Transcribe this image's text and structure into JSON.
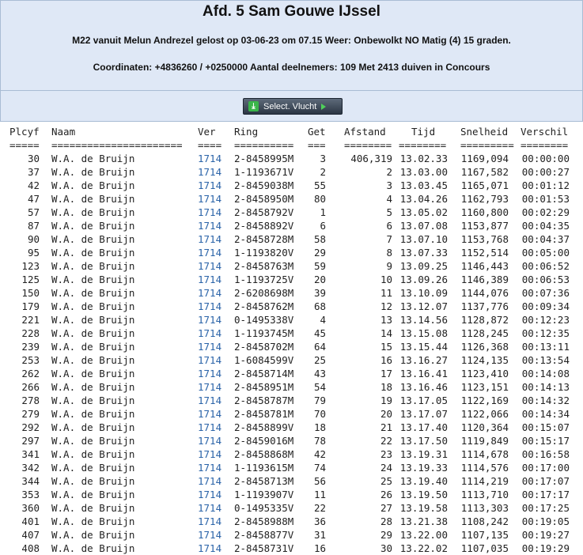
{
  "header": {
    "title": "Afd. 5 Sam Gouwe IJssel",
    "subtitle": "M22 vanuit Melun Andrezel gelost op 03-06-23 om 07.15 Weer: Onbewolkt NO Matig (4) 15 graden.",
    "coords": "Coordinaten: +4836260 / +0250000 Aantal deelnemers: 109 Met 2413 duiven in Concours"
  },
  "toolbar": {
    "select_label": "Select. Vlucht"
  },
  "table": {
    "headers": [
      "Plcyf",
      "Naam",
      "Ver",
      "Ring",
      "Get",
      "Afstand",
      "Tijd",
      "Snelheid",
      "Verschil"
    ],
    "underlines": [
      "=====",
      "======================",
      "====",
      "==========",
      "===",
      "========",
      "========",
      "=========",
      "========"
    ],
    "rows": [
      [
        "30",
        "W.A. de Bruijn",
        "1714",
        "2-8458995M",
        "3",
        "406,319",
        "13.02.33",
        "1169,094",
        "00:00:00"
      ],
      [
        "37",
        "W.A. de Bruijn",
        "1714",
        "1-1193671V",
        "2",
        "2",
        "13.03.00",
        "1167,582",
        "00:00:27"
      ],
      [
        "42",
        "W.A. de Bruijn",
        "1714",
        "2-8459038M",
        "55",
        "3",
        "13.03.45",
        "1165,071",
        "00:01:12"
      ],
      [
        "47",
        "W.A. de Bruijn",
        "1714",
        "2-8458950M",
        "80",
        "4",
        "13.04.26",
        "1162,793",
        "00:01:53"
      ],
      [
        "57",
        "W.A. de Bruijn",
        "1714",
        "2-8458792V",
        "1",
        "5",
        "13.05.02",
        "1160,800",
        "00:02:29"
      ],
      [
        "87",
        "W.A. de Bruijn",
        "1714",
        "2-8458892V",
        "6",
        "6",
        "13.07.08",
        "1153,877",
        "00:04:35"
      ],
      [
        "90",
        "W.A. de Bruijn",
        "1714",
        "2-8458728M",
        "58",
        "7",
        "13.07.10",
        "1153,768",
        "00:04:37"
      ],
      [
        "95",
        "W.A. de Bruijn",
        "1714",
        "1-1193820V",
        "29",
        "8",
        "13.07.33",
        "1152,514",
        "00:05:00"
      ],
      [
        "123",
        "W.A. de Bruijn",
        "1714",
        "2-8458763M",
        "59",
        "9",
        "13.09.25",
        "1146,443",
        "00:06:52"
      ],
      [
        "125",
        "W.A. de Bruijn",
        "1714",
        "1-1193725V",
        "20",
        "10",
        "13.09.26",
        "1146,389",
        "00:06:53"
      ],
      [
        "150",
        "W.A. de Bruijn",
        "1714",
        "2-6208698M",
        "39",
        "11",
        "13.10.09",
        "1144,076",
        "00:07:36"
      ],
      [
        "179",
        "W.A. de Bruijn",
        "1714",
        "2-8458762M",
        "68",
        "12",
        "13.12.07",
        "1137,776",
        "00:09:34"
      ],
      [
        "221",
        "W.A. de Bruijn",
        "1714",
        "0-1495338V",
        "4",
        "13",
        "13.14.56",
        "1128,872",
        "00:12:23"
      ],
      [
        "228",
        "W.A. de Bruijn",
        "1714",
        "1-1193745M",
        "45",
        "14",
        "13.15.08",
        "1128,245",
        "00:12:35"
      ],
      [
        "239",
        "W.A. de Bruijn",
        "1714",
        "2-8458702M",
        "64",
        "15",
        "13.15.44",
        "1126,368",
        "00:13:11"
      ],
      [
        "253",
        "W.A. de Bruijn",
        "1714",
        "1-6084599V",
        "25",
        "16",
        "13.16.27",
        "1124,135",
        "00:13:54"
      ],
      [
        "262",
        "W.A. de Bruijn",
        "1714",
        "2-8458714M",
        "43",
        "17",
        "13.16.41",
        "1123,410",
        "00:14:08"
      ],
      [
        "266",
        "W.A. de Bruijn",
        "1714",
        "2-8458951M",
        "54",
        "18",
        "13.16.46",
        "1123,151",
        "00:14:13"
      ],
      [
        "278",
        "W.A. de Bruijn",
        "1714",
        "2-8458787M",
        "79",
        "19",
        "13.17.05",
        "1122,169",
        "00:14:32"
      ],
      [
        "279",
        "W.A. de Bruijn",
        "1714",
        "2-8458781M",
        "70",
        "20",
        "13.17.07",
        "1122,066",
        "00:14:34"
      ],
      [
        "292",
        "W.A. de Bruijn",
        "1714",
        "2-8458899V",
        "18",
        "21",
        "13.17.40",
        "1120,364",
        "00:15:07"
      ],
      [
        "297",
        "W.A. de Bruijn",
        "1714",
        "2-8459016M",
        "78",
        "22",
        "13.17.50",
        "1119,849",
        "00:15:17"
      ],
      [
        "341",
        "W.A. de Bruijn",
        "1714",
        "2-8458868M",
        "42",
        "23",
        "13.19.31",
        "1114,678",
        "00:16:58"
      ],
      [
        "342",
        "W.A. de Bruijn",
        "1714",
        "1-1193615M",
        "74",
        "24",
        "13.19.33",
        "1114,576",
        "00:17:00"
      ],
      [
        "344",
        "W.A. de Bruijn",
        "1714",
        "2-8458713M",
        "56",
        "25",
        "13.19.40",
        "1114,219",
        "00:17:07"
      ],
      [
        "353",
        "W.A. de Bruijn",
        "1714",
        "1-1193907V",
        "11",
        "26",
        "13.19.50",
        "1113,710",
        "00:17:17"
      ],
      [
        "360",
        "W.A. de Bruijn",
        "1714",
        "0-1495335V",
        "22",
        "27",
        "13.19.58",
        "1113,303",
        "00:17:25"
      ],
      [
        "401",
        "W.A. de Bruijn",
        "1714",
        "2-8458988M",
        "36",
        "28",
        "13.21.38",
        "1108,242",
        "00:19:05"
      ],
      [
        "407",
        "W.A. de Bruijn",
        "1714",
        "2-8458877V",
        "31",
        "29",
        "13.22.00",
        "1107,135",
        "00:19:27"
      ],
      [
        "408",
        "W.A. de Bruijn",
        "1714",
        "2-8458731V",
        "16",
        "30",
        "13.22.02",
        "1107,035",
        "00:19:29"
      ]
    ]
  }
}
